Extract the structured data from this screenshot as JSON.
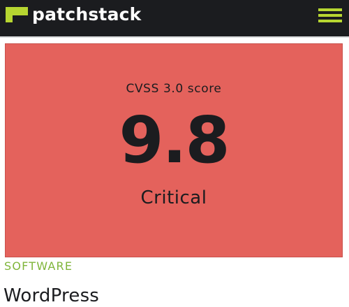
{
  "header": {
    "brand": "patchstack",
    "logo_icon": "patchstack-logo-icon",
    "menu_icon": "hamburger-menu-icon",
    "accent_color": "#b7d631"
  },
  "score_card": {
    "label": "CVSS 3.0 score",
    "value": "9.8",
    "severity": "Critical",
    "background_color": "#e4625c"
  },
  "software": {
    "section_label": "SOFTWARE",
    "name": "WordPress",
    "label_color": "#7fb53a"
  }
}
